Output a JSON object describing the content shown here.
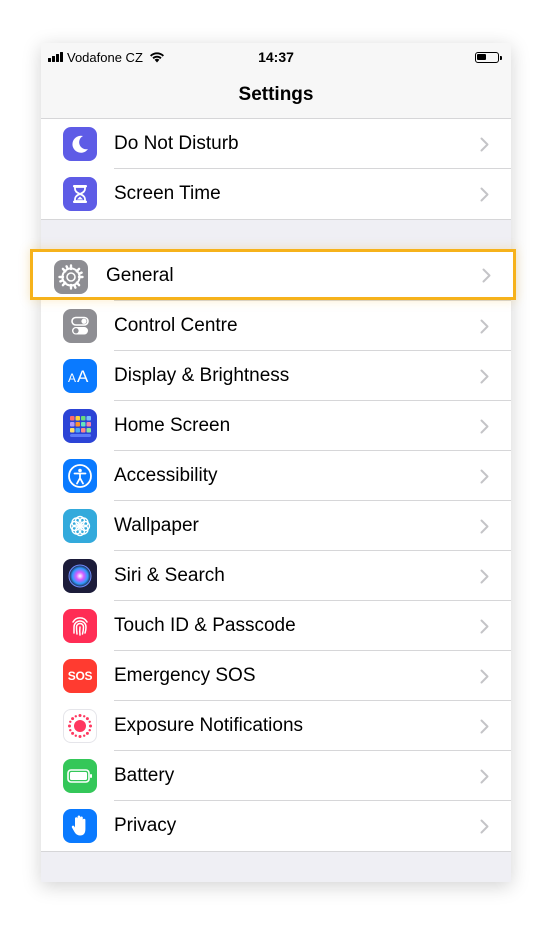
{
  "status_bar": {
    "carrier": "Vodafone CZ",
    "time": "14:37"
  },
  "nav": {
    "title": "Settings"
  },
  "top_items": [
    {
      "label": "Do Not Disturb",
      "icon": "moon-icon",
      "color": "#5e5ce6"
    },
    {
      "label": "Screen Time",
      "icon": "hourglass-icon",
      "color": "#5e5ce6"
    }
  ],
  "general": {
    "label": "General",
    "icon": "gear-icon",
    "color": "#8e8e93",
    "highlight_color": "#f6b21b"
  },
  "main_items": [
    {
      "label": "Control Centre",
      "icon": "toggles-icon",
      "color": "#8e8e93"
    },
    {
      "label": "Display & Brightness",
      "icon": "text-size-icon",
      "color": "#0a7aff"
    },
    {
      "label": "Home Screen",
      "icon": "app-grid-icon",
      "color": "#2c44d6"
    },
    {
      "label": "Accessibility",
      "icon": "accessibility-icon",
      "color": "#0a7aff"
    },
    {
      "label": "Wallpaper",
      "icon": "flower-icon",
      "color": "#33aadc"
    },
    {
      "label": "Siri & Search",
      "icon": "siri-icon",
      "color": "#1c1c3a"
    },
    {
      "label": "Touch ID & Passcode",
      "icon": "fingerprint-icon",
      "color": "#ff2d55"
    },
    {
      "label": "Emergency SOS",
      "icon": "sos-icon",
      "color": "#ff3b30",
      "icon_text": "SOS"
    },
    {
      "label": "Exposure Notifications",
      "icon": "exposure-icon",
      "color": "#ffffff"
    },
    {
      "label": "Battery",
      "icon": "battery-icon",
      "color": "#34c759"
    },
    {
      "label": "Privacy",
      "icon": "hand-icon",
      "color": "#0a7aff"
    }
  ]
}
